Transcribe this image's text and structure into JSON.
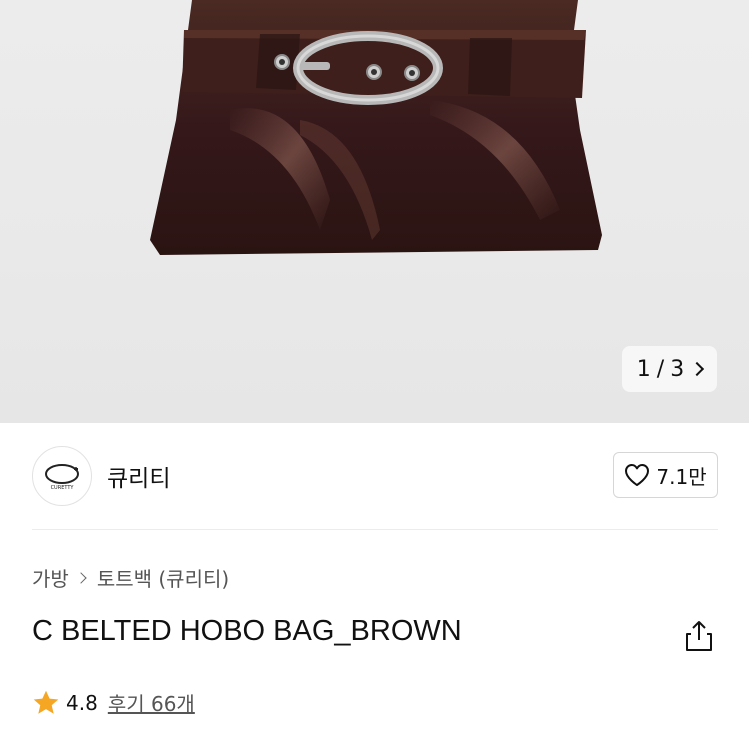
{
  "gallery": {
    "current": "1",
    "separator": "/",
    "total": "3"
  },
  "brand": {
    "name": "큐리티",
    "logo_text": "CURETTY"
  },
  "likes": {
    "count": "7.1만"
  },
  "breadcrumb": {
    "category": "가방",
    "subcategory": "토트백 (큐리티)"
  },
  "product": {
    "title": "C BELTED HOBO BAG_BROWN"
  },
  "rating": {
    "score": "4.8",
    "reviews_label": "후기 66개"
  },
  "colors": {
    "star": "#f5a623",
    "bag_brown": "#3a1f1a",
    "buckle": "#b8b8b8"
  },
  "icons": [
    "chevron-right-icon",
    "heart-icon",
    "share-icon",
    "star-icon"
  ]
}
